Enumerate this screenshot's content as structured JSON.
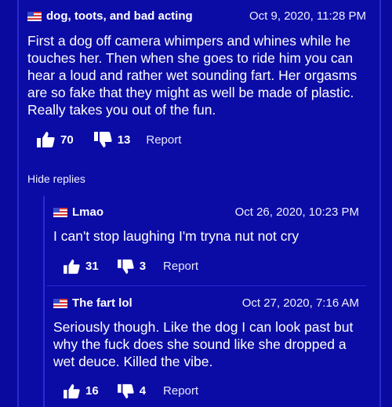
{
  "comment": {
    "author": "dog, toots, and bad acting",
    "date": "Oct 9, 2020, 11:28 PM",
    "body": "First a dog off camera whimpers and whines while he touches her. Then when she goes to ride him you can hear a loud and rather wet sounding fart. Her orgasms are so fake that they might as well be made of plastic. Really takes you out of the fun.",
    "likes": "70",
    "dislikes": "13",
    "report_label": "Report"
  },
  "hide_replies_label": "Hide replies",
  "replies": [
    {
      "author": "Lmao",
      "date": "Oct 26, 2020, 10:23 PM",
      "body": "I can't stop laughing I'm tryna nut not cry",
      "likes": "31",
      "dislikes": "3",
      "report_label": "Report"
    },
    {
      "author": "The fart lol",
      "date": "Oct 27, 2020, 7:16 AM",
      "body": "Seriously though. Like the dog I can look past but why the fuck does she sound like she dropped a wet deuce. Killed the vibe.",
      "likes": "16",
      "dislikes": "4",
      "report_label": "Report"
    }
  ],
  "icons": {
    "flag": "us-flag-icon",
    "like": "thumbs-up-icon",
    "dislike": "thumbs-down-icon"
  },
  "colors": {
    "background": "#0a0a9e",
    "border": "#2a2ad0",
    "text": "#ffffff"
  }
}
